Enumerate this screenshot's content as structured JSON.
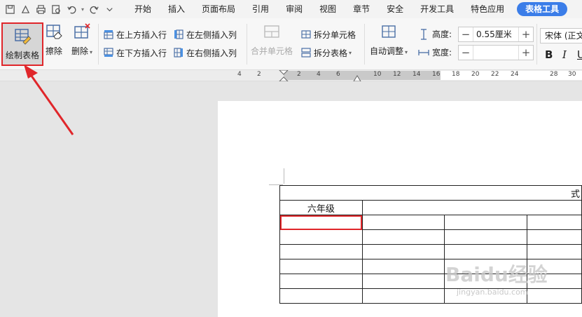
{
  "menubar": {
    "tabs": [
      "开始",
      "插入",
      "页面布局",
      "引用",
      "审阅",
      "视图",
      "章节",
      "安全",
      "开发工具",
      "特色应用"
    ],
    "active_tab": "表格工具"
  },
  "ribbon": {
    "draw_table": "绘制表格",
    "erase": "擦除",
    "delete": "删除",
    "insert_above": "在上方插入行",
    "insert_below": "在下方插入行",
    "insert_left": "在左侧插入列",
    "insert_right": "在右侧插入列",
    "merge_cells": "合并单元格",
    "split_cells": "拆分单元格",
    "split_table": "拆分表格",
    "auto_fit": "自动调整",
    "height_label": "高度:",
    "height_value": "0.55厘米",
    "width_label": "宽度:",
    "width_value": "",
    "font_name": "宋体 (正文",
    "bold": "B",
    "italic": "I",
    "underline": "U"
  },
  "ruler": {
    "numbers": [
      "4",
      "2",
      "2",
      "4",
      "6",
      "10",
      "12",
      "14",
      "16",
      "18",
      "20",
      "22",
      "24",
      "28",
      "30"
    ]
  },
  "document": {
    "header_cell": "六年级",
    "top_right_fragment": "式"
  },
  "watermark": {
    "main": "Baidu经验",
    "sub": "jingyan.baidu.com"
  },
  "colors": {
    "accent": "#3b7de8",
    "highlight": "#e0262a"
  }
}
